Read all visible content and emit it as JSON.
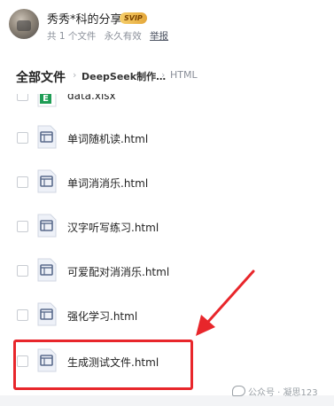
{
  "share": {
    "owner": "秀秀*科的分享",
    "badge": "SVIP",
    "file_count": "共 1 个文件",
    "validity": "永久有效",
    "report": "举报"
  },
  "breadcrumb": {
    "root": "全部文件",
    "folder": "DeepSeek制作…",
    "current": "HTML"
  },
  "files": [
    {
      "name": "data.xlsx",
      "type": "excel"
    },
    {
      "name": "单词随机读.html",
      "type": "html"
    },
    {
      "name": "单词消消乐.html",
      "type": "html"
    },
    {
      "name": "汉字听写练习.html",
      "type": "html"
    },
    {
      "name": "可爱配对消消乐.html",
      "type": "html"
    },
    {
      "name": "强化学习.html",
      "type": "html"
    },
    {
      "name": "生成测试文件.html",
      "type": "html"
    }
  ],
  "bottom_partial": "… … … … …",
  "watermark": "公众号 · 凝思123",
  "colors": {
    "highlight": "#e8262b",
    "excel": "#1f9d55",
    "html_icon_bg": "#eef1f8",
    "html_icon_frame": "#5a6b8c"
  }
}
